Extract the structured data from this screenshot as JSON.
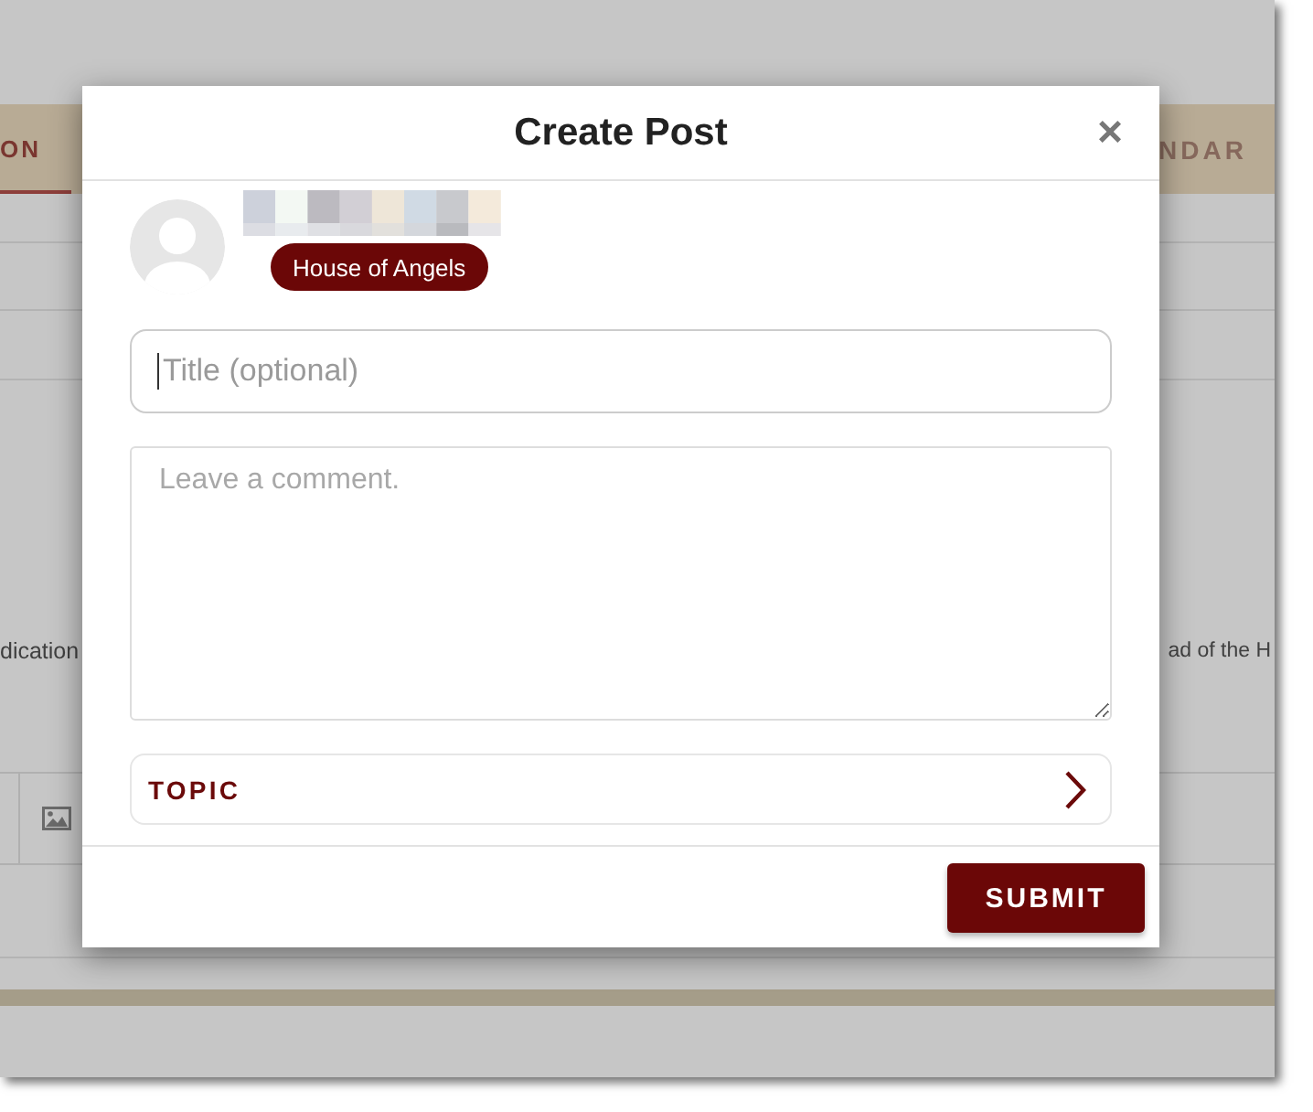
{
  "background": {
    "nav_tabs": [
      {
        "label": "ON",
        "selected": true
      },
      {
        "label": "NDAR",
        "selected": false
      }
    ],
    "text_left": "dication",
    "text_right": "ad of the H"
  },
  "modal": {
    "title": "Create Post",
    "close": "×",
    "badge": "House of Angels",
    "title_field": {
      "placeholder": "Title (optional)",
      "focused": true
    },
    "comment_field": {
      "placeholder": "Leave a comment."
    },
    "topic": {
      "label": "TOPIC"
    },
    "submit": "SUBMIT"
  }
}
